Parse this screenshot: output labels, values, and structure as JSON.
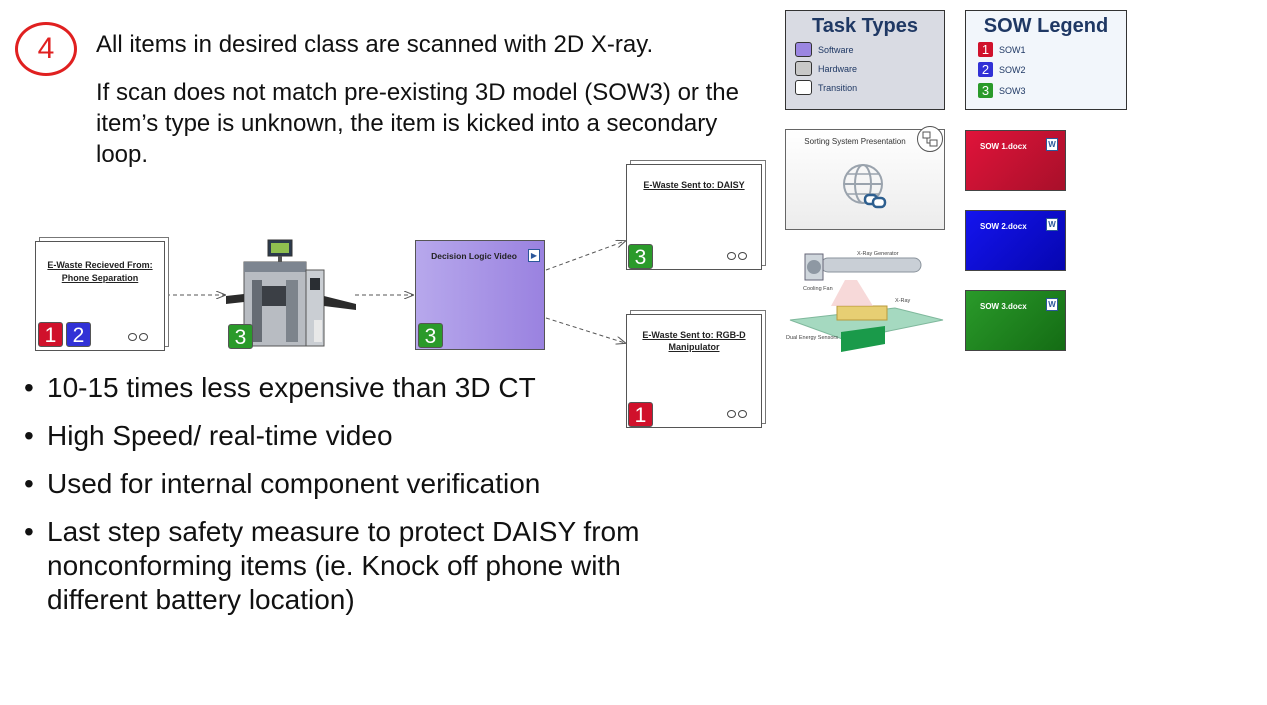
{
  "step": {
    "number": "4",
    "line1": "All items in desired class are scanned with 2D X-ray.",
    "line2": "If scan does not match pre-existing 3D model (SOW3) or the item’s type is unknown, the item is kicked into a secondary loop."
  },
  "nodes": {
    "received": {
      "label_line1": "E-Waste Recieved From:",
      "label_line2": "Phone Separation",
      "badges": [
        "1",
        "2"
      ]
    },
    "scanner": {
      "badge": "3"
    },
    "decision": {
      "label": "Decision Logic Video",
      "badge": "3"
    },
    "daisy": {
      "label": "E-Waste Sent to: DAISY",
      "badge": "3"
    },
    "rgbd": {
      "label_line1": "E-Waste Sent to: RGB-D",
      "label_line2": "Manipulator",
      "badge": "1"
    }
  },
  "bullets": [
    "10-15 times less expensive than 3D CT",
    "High Speed/ real-time video",
    "Used for internal component verification",
    "Last step safety measure to protect DAISY from nonconforming items (ie. Knock off phone with different battery location)"
  ],
  "task_types": {
    "title": "Task Types",
    "items": [
      {
        "label": "Software",
        "color": "#9b86e2"
      },
      {
        "label": "Hardware",
        "color": "#c8c8c8"
      },
      {
        "label": "Transition",
        "color": "#ffffff"
      }
    ]
  },
  "sow_legend": {
    "title": "SOW Legend",
    "items": [
      {
        "number": "1",
        "label": "SOW1",
        "color": "#d0112b"
      },
      {
        "number": "2",
        "label": "SOW2",
        "color": "#3131d6"
      },
      {
        "number": "3",
        "label": "SOW3",
        "color": "#2a9a2a"
      }
    ]
  },
  "presentation": {
    "label": "Sorting System Presentation"
  },
  "xray_diagram": {
    "labels": [
      "X-Ray Generator",
      "Cooling Fan",
      "X-Ray",
      "Dual Energy Sensors"
    ]
  },
  "sow_docs": [
    {
      "label": "SOW 1.docx",
      "color": "#c8102e"
    },
    {
      "label": "SOW 2.docx",
      "color": "#0a0ad8"
    },
    {
      "label": "SOW 3.docx",
      "color": "#1e8a1e"
    }
  ]
}
